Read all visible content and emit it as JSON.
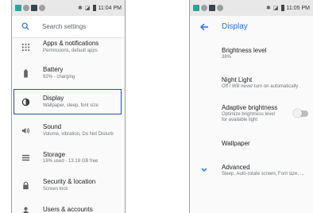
{
  "left_phone": {
    "status_bar": {
      "time": "11:04 PM"
    },
    "search": {
      "placeholder": "Search settings"
    },
    "items": [
      {
        "title": "Apps & notifications",
        "subtitle": "Permissions, default apps",
        "icon": "apps-grid-icon"
      },
      {
        "title": "Battery",
        "subtitle": "92% - charging",
        "icon": "battery-icon"
      },
      {
        "title": "Display",
        "subtitle": "Wallpaper, sleep, font size",
        "icon": "brightness-icon"
      },
      {
        "title": "Sound",
        "subtitle": "Volume, vibration, Do Not Disturb",
        "icon": "volume-icon"
      },
      {
        "title": "Storage",
        "subtitle": "18% used - 13.18 GB free",
        "icon": "storage-icon"
      },
      {
        "title": "Security & location",
        "subtitle": "Screen lock",
        "icon": "lock-icon"
      },
      {
        "title": "Users & accounts",
        "subtitle": "",
        "icon": "person-icon"
      }
    ]
  },
  "right_phone": {
    "status_bar": {
      "time": "11:05 PM"
    },
    "header": {
      "title": "Display"
    },
    "items": [
      {
        "title": "Brightness level",
        "subtitle": "38%"
      },
      {
        "title": "Night Light",
        "subtitle": "Off / Will never turn on automatically"
      },
      {
        "title": "Adaptive brightness",
        "subtitle": "Optimize brightness level",
        "subtitle2": "for available light",
        "toggle": "off"
      },
      {
        "title": "Wallpaper",
        "subtitle": ""
      },
      {
        "title": "Advanced",
        "subtitle": "Sleep, Auto-rotate screen, Font size, ..."
      }
    ]
  },
  "colors": {
    "accent": "#1a73e8",
    "selection_outline": "#2952a3",
    "icon": "#5f6368"
  }
}
